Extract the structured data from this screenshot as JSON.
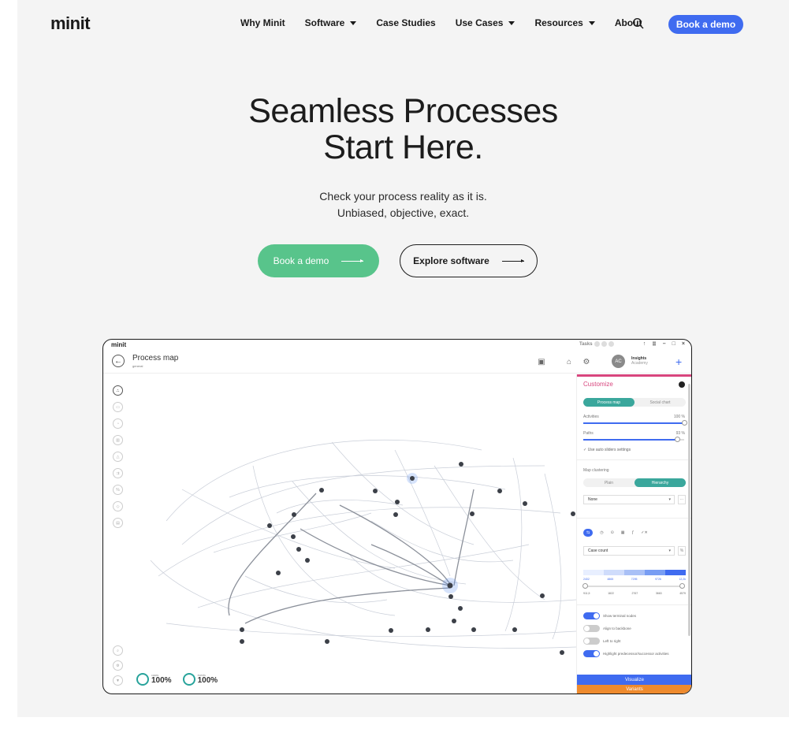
{
  "nav": {
    "logo": "minit",
    "items": [
      {
        "label": "Why Minit",
        "dropdown": false
      },
      {
        "label": "Software",
        "dropdown": true
      },
      {
        "label": "Case Studies",
        "dropdown": false
      },
      {
        "label": "Use Cases",
        "dropdown": true
      },
      {
        "label": "Resources",
        "dropdown": true
      },
      {
        "label": "About",
        "dropdown": false
      }
    ],
    "search_icon": "search-icon",
    "cta": "Book a demo"
  },
  "hero": {
    "title_line1": "Seamless Processes",
    "title_line2": "Start Here.",
    "subtitle_line1": "Check your process reality as it is.",
    "subtitle_line2": "Unbiased, objective, exact.",
    "primary_cta": "Book a demo",
    "secondary_cta": "Explore software"
  },
  "app": {
    "logo": "minit",
    "tasks_label": "Tasks",
    "window_controls": [
      "↑",
      "⠿",
      "–",
      "□",
      "×"
    ],
    "title": "Process map",
    "view": "general",
    "avatar": "AC",
    "account_name": "Insights",
    "account_sub": "Academy",
    "stats": [
      {
        "label": "cases",
        "value": "100%"
      },
      {
        "label": "events",
        "value": "100%"
      }
    ],
    "panel": {
      "title": "Customize",
      "tabs": [
        "Process map",
        "Social chart"
      ],
      "activities_label": "Activities",
      "activities_pct": "100 %",
      "activities_level": 1.0,
      "paths_label": "Paths",
      "paths_pct": "93 %",
      "paths_level": 0.93,
      "auto_sliders": "Use auto sliders settings",
      "clustering_label": "Map clustering",
      "clustering_options": [
        "Plain",
        "Hierarchy"
      ],
      "clustering_select": "None",
      "metric_select": "Case count",
      "metric_unit": "%",
      "scale_top": [
        "2402",
        "4865",
        "7295",
        "9726",
        "12,2k"
      ],
      "scale_bottom": [
        "911,5",
        "1822",
        "2767",
        "3663",
        "4579"
      ],
      "toggles": [
        {
          "label": "Show terminal nodes",
          "on": true
        },
        {
          "label": "Align to backbone",
          "on": false
        },
        {
          "label": "Left to right",
          "on": false
        },
        {
          "label": "Highlight predecessor/successor activities",
          "on": true
        }
      ],
      "visualize": "Visualize",
      "variants": "Variants",
      "accent": "#d8467e",
      "teal": "#3aa79c",
      "blue": "#3f6bf0",
      "orange": "#ee8a2d"
    }
  }
}
